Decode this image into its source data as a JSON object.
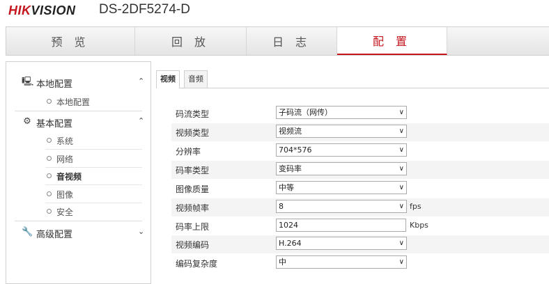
{
  "header": {
    "logo_red": "HIK",
    "logo_rest": "VISION",
    "model": "DS-2DF5274-D"
  },
  "nav": {
    "tabs": [
      "预 览",
      "回 放",
      "日 志",
      "配 置"
    ],
    "active": "配 置"
  },
  "sidebar": {
    "local": {
      "label": "本地配置",
      "items": [
        "本地配置"
      ]
    },
    "basic": {
      "label": "基本配置",
      "items": [
        "系统",
        "网络",
        "音视频",
        "图像",
        "安全"
      ]
    },
    "advanced": {
      "label": "高级配置"
    }
  },
  "subtabs": [
    "视频",
    "音频"
  ],
  "form": {
    "stream_type": {
      "label": "码流类型",
      "value": "子码流（网传）"
    },
    "video_type": {
      "label": "视频类型",
      "value": "视频流"
    },
    "resolution": {
      "label": "分辨率",
      "value": "704*576"
    },
    "bitrate_type": {
      "label": "码率类型",
      "value": "变码率"
    },
    "image_quality": {
      "label": "图像质量",
      "value": "中等"
    },
    "frame_rate": {
      "label": "视频帧率",
      "value": "8",
      "unit": "fps"
    },
    "max_bitrate": {
      "label": "码率上限",
      "value": "1024",
      "unit": "Kbps"
    },
    "encoding": {
      "label": "视频编码",
      "value": "H.264"
    },
    "complexity": {
      "label": "编码复杂度",
      "value": "中"
    }
  },
  "colors": {
    "brand_red": "#c4161c"
  }
}
